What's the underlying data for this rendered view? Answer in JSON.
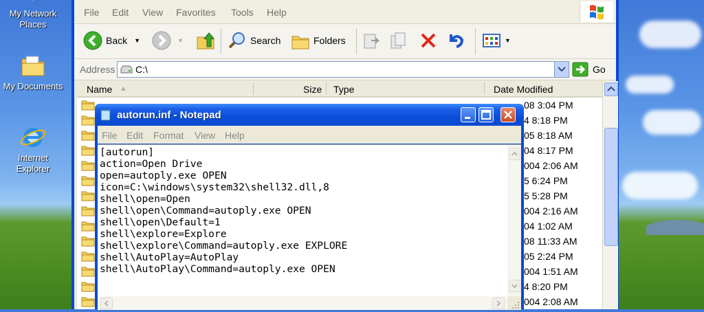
{
  "desktop": {
    "icons": [
      {
        "label_line1": "My Network",
        "label_line2": "Places"
      },
      {
        "label_line1": "My Documents",
        "label_line2": ""
      },
      {
        "label_line1": "Internet",
        "label_line2": "Explorer"
      }
    ]
  },
  "explorer": {
    "menu": [
      "File",
      "Edit",
      "View",
      "Favorites",
      "Tools",
      "Help"
    ],
    "toolbar": {
      "back_label": "Back",
      "search_label": "Search",
      "folders_label": "Folders"
    },
    "address": {
      "label": "Address",
      "value": "C:\\",
      "go_label": "Go"
    },
    "columns": {
      "name": "Name",
      "size": "Size",
      "type": "Type",
      "date": "Date Modified"
    },
    "rows": [
      {
        "date": "08 3:04 PM"
      },
      {
        "date": "4 8:18 PM"
      },
      {
        "date": "05 8:18 AM"
      },
      {
        "date": "04 8:17 PM"
      },
      {
        "date": "004 2:06 AM"
      },
      {
        "date": "5 6:24 PM"
      },
      {
        "date": "5 5:28 PM"
      },
      {
        "date": "004 2:16 AM"
      },
      {
        "date": "04 1:02 AM"
      },
      {
        "date": "08 11:33 AM"
      },
      {
        "date": "05 2:24 PM"
      },
      {
        "date": "004 1:51 AM"
      },
      {
        "date": "4 8:20 PM"
      },
      {
        "date": "004 2:08 AM"
      }
    ]
  },
  "notepad": {
    "title": "autorun.inf - Notepad",
    "menu": [
      "File",
      "Edit",
      "Format",
      "View",
      "Help"
    ],
    "content": "[autorun]\naction=Open Drive\nopen=autoply.exe OPEN\nicon=C:\\windows\\system32\\shell32.dll,8\nshell\\open=Open\nshell\\open\\Command=autoply.exe OPEN\nshell\\open\\Default=1\nshell\\explore=Explore\nshell\\explore\\Command=autoply.exe EXPLORE\nshell\\AutoPlay=AutoPlay\nshell\\AutoPlay\\Command=autoply.exe OPEN"
  }
}
